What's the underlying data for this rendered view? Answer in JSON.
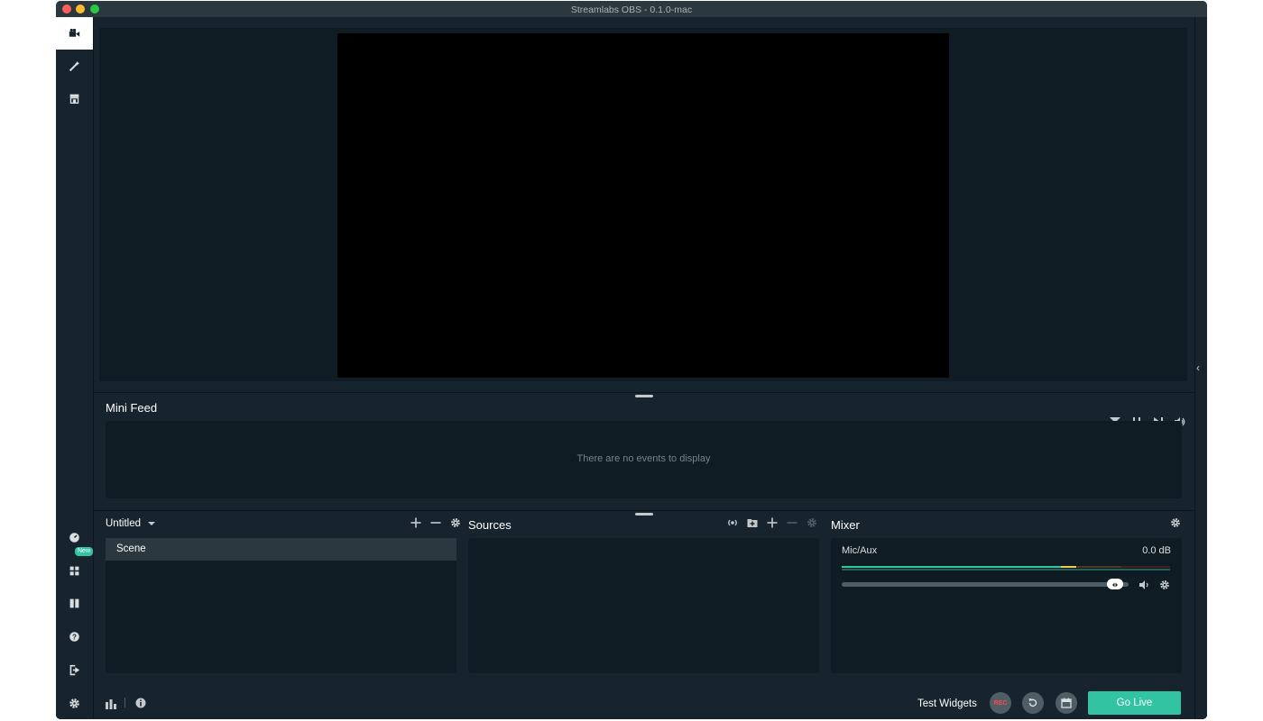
{
  "window": {
    "title": "Streamlabs OBS - 0.1.0-mac"
  },
  "sidebar": {
    "top_items": [
      {
        "name": "editor",
        "icon": "video-camera-icon",
        "active": true
      },
      {
        "name": "themes",
        "icon": "magic-wand-icon",
        "active": false
      },
      {
        "name": "store",
        "icon": "store-icon",
        "active": false
      }
    ],
    "bottom_items": [
      {
        "name": "dashboard",
        "icon": "dashboard-icon"
      },
      {
        "name": "layouts",
        "icon": "apps-grid-icon",
        "badge": "New"
      },
      {
        "name": "columns",
        "icon": "columns-icon"
      },
      {
        "name": "help",
        "icon": "help-circle-icon"
      },
      {
        "name": "logout",
        "icon": "logout-icon"
      },
      {
        "name": "settings",
        "icon": "gear-icon"
      }
    ]
  },
  "mini_feed": {
    "title": "Mini Feed",
    "empty_text": "There are no events to display",
    "controls": [
      "filter-icon",
      "pause-icon",
      "skip-icon",
      "volume-icon"
    ]
  },
  "scenes": {
    "collection_name": "Untitled",
    "items": [
      {
        "label": "Scene",
        "selected": true
      }
    ]
  },
  "sources": {
    "title": "Sources",
    "items": []
  },
  "mixer": {
    "title": "Mixer",
    "channels": [
      {
        "name": "Mic/Aux",
        "level": "0.0 dB",
        "volume_fraction": 0.95
      }
    ]
  },
  "footer": {
    "test_widgets_label": "Test Widgets",
    "rec_label": "REC",
    "go_live_label": "Go Live"
  },
  "colors": {
    "accent": "#31c3a2",
    "background": "#17242d",
    "panel": "#0f1c23",
    "rec_red": "#fb4b4b",
    "meter_yellow": "#f5c84a"
  }
}
